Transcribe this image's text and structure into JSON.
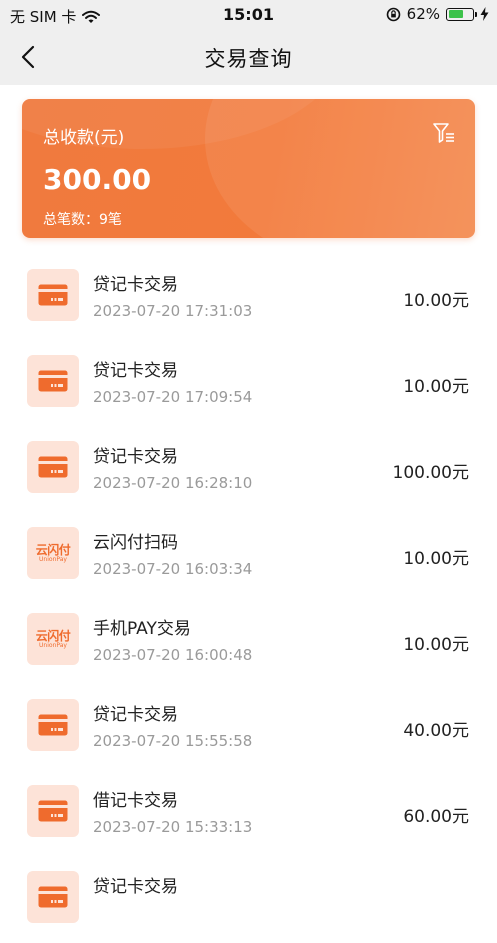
{
  "status_bar": {
    "carrier": "无 SIM 卡",
    "time": "15:01",
    "battery_percent": "62%",
    "battery_level": 0.62,
    "icons": [
      "wifi-icon",
      "rotation-lock-icon",
      "battery-icon",
      "charging-icon"
    ]
  },
  "nav": {
    "title": "交易查询",
    "back_icon": "chevron-left-icon"
  },
  "summary": {
    "label": "总收款(元)",
    "amount": "300.00",
    "count_text": "总笔数：9笔",
    "filter_icon": "filter-icon"
  },
  "colors": {
    "accent": "#f27a3b",
    "icon_bg": "#fde3d8",
    "amount_text": "#222222",
    "time_text": "#9a9a9a"
  },
  "transactions": [
    {
      "icon": "card-icon",
      "name": "贷记卡交易",
      "time": "2023-07-20 17:31:03",
      "amount": "10.00元"
    },
    {
      "icon": "card-icon",
      "name": "贷记卡交易",
      "time": "2023-07-20 17:09:54",
      "amount": "10.00元"
    },
    {
      "icon": "card-icon",
      "name": "贷记卡交易",
      "time": "2023-07-20 16:28:10",
      "amount": "100.00元"
    },
    {
      "icon": "unionpay-icon",
      "name": "云闪付扫码",
      "time": "2023-07-20 16:03:34",
      "amount": "10.00元",
      "logo_cn": "云闪付",
      "logo_en": "UnionPay"
    },
    {
      "icon": "unionpay-icon",
      "name": "手机PAY交易",
      "time": "2023-07-20 16:00:48",
      "amount": "10.00元",
      "logo_cn": "云闪付",
      "logo_en": "UnionPay"
    },
    {
      "icon": "card-icon",
      "name": "贷记卡交易",
      "time": "2023-07-20 15:55:58",
      "amount": "40.00元"
    },
    {
      "icon": "card-icon",
      "name": "借记卡交易",
      "time": "2023-07-20 15:33:13",
      "amount": "60.00元"
    },
    {
      "icon": "card-icon",
      "name": "贷记卡交易",
      "time": "",
      "amount": ""
    }
  ]
}
